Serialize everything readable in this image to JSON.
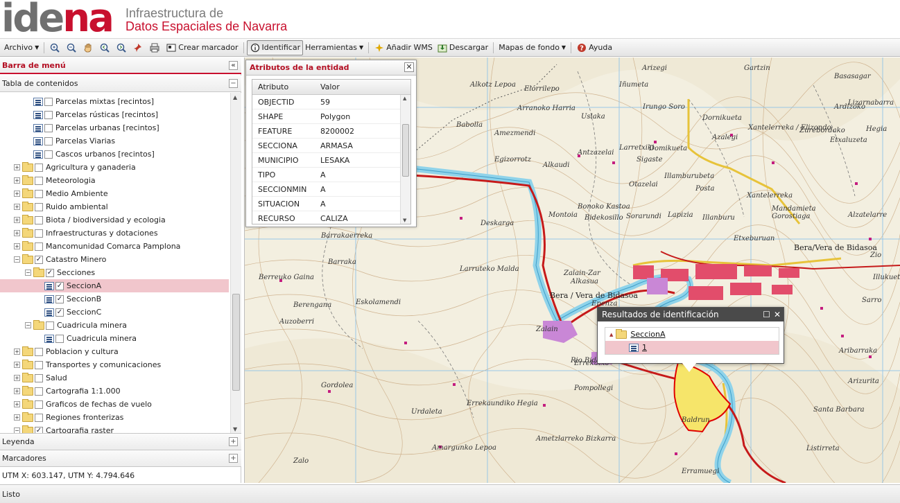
{
  "header": {
    "logo_part1": "ide",
    "logo_part2": "na",
    "subtitle_line1": "Infraestructura de",
    "subtitle_line2": "Datos Espaciales de Navarra"
  },
  "toolbar": {
    "archivo": "Archivo",
    "crear_marcador": "Crear marcador",
    "identificar": "Identificar",
    "herramientas": "Herramientas",
    "anadir_wms": "Añadir WMS",
    "descargar": "Descargar",
    "mapas_fondo": "Mapas de fondo",
    "ayuda": "Ayuda"
  },
  "left_panel": {
    "title": "Barra de menú",
    "toc_title": "Tabla de contenidos",
    "legend_title": "Leyenda",
    "bookmarks_title": "Marcadores",
    "coords": "UTM X: 603.147, UTM Y: 4.794.646"
  },
  "tree": [
    {
      "label": "Parcelas mixtas [recintos]",
      "type": "layer",
      "level": 2,
      "checked": false,
      "expander": "",
      "selected": false
    },
    {
      "label": "Parcelas rústicas [recintos]",
      "type": "layer",
      "level": 2,
      "checked": false,
      "expander": "",
      "selected": false
    },
    {
      "label": "Parcelas urbanas [recintos]",
      "type": "layer",
      "level": 2,
      "checked": false,
      "expander": "",
      "selected": false
    },
    {
      "label": "Parcelas Viarias",
      "type": "layer",
      "level": 2,
      "checked": false,
      "expander": "",
      "selected": false
    },
    {
      "label": "Cascos urbanos [recintos]",
      "type": "layer",
      "level": 2,
      "checked": false,
      "expander": "",
      "selected": false
    },
    {
      "label": "Agricultura y ganaderia",
      "type": "folder",
      "level": 0,
      "checked": false,
      "expander": "+",
      "selected": false
    },
    {
      "label": "Meteorologia",
      "type": "folder",
      "level": 0,
      "checked": false,
      "expander": "+",
      "selected": false
    },
    {
      "label": "Medio Ambiente",
      "type": "folder",
      "level": 0,
      "checked": false,
      "expander": "+",
      "selected": false
    },
    {
      "label": "Ruido ambiental",
      "type": "folder",
      "level": 0,
      "checked": false,
      "expander": "+",
      "selected": false
    },
    {
      "label": "Biota / biodiversidad y ecologia",
      "type": "folder",
      "level": 0,
      "checked": false,
      "expander": "+",
      "selected": false
    },
    {
      "label": "Infraestructuras y dotaciones",
      "type": "folder",
      "level": 0,
      "checked": false,
      "expander": "+",
      "selected": false
    },
    {
      "label": "Mancomunidad Comarca Pamplona",
      "type": "folder",
      "level": 0,
      "checked": false,
      "expander": "+",
      "selected": false
    },
    {
      "label": "Catastro Minero",
      "type": "folder",
      "level": 0,
      "checked": true,
      "expander": "−",
      "selected": false
    },
    {
      "label": "Secciones",
      "type": "folder",
      "level": 1,
      "checked": true,
      "expander": "−",
      "selected": false
    },
    {
      "label": "SeccionA",
      "type": "layer",
      "level": 3,
      "checked": true,
      "expander": "",
      "selected": true
    },
    {
      "label": "SeccionB",
      "type": "layer",
      "level": 3,
      "checked": true,
      "expander": "",
      "selected": false
    },
    {
      "label": "SeccionC",
      "type": "layer",
      "level": 3,
      "checked": true,
      "expander": "",
      "selected": false
    },
    {
      "label": "Cuadricula minera",
      "type": "folder",
      "level": 1,
      "checked": false,
      "expander": "−",
      "selected": false
    },
    {
      "label": "Cuadricula minera",
      "type": "layer",
      "level": 3,
      "checked": false,
      "expander": "",
      "selected": false
    },
    {
      "label": "Poblacion y cultura",
      "type": "folder",
      "level": 0,
      "checked": false,
      "expander": "+",
      "selected": false
    },
    {
      "label": "Transportes y comunicaciones",
      "type": "folder",
      "level": 0,
      "checked": false,
      "expander": "+",
      "selected": false
    },
    {
      "label": "Salud",
      "type": "folder",
      "level": 0,
      "checked": false,
      "expander": "+",
      "selected": false
    },
    {
      "label": "Cartografia 1:1.000",
      "type": "folder",
      "level": 0,
      "checked": false,
      "expander": "+",
      "selected": false
    },
    {
      "label": "Graficos de fechas de vuelo",
      "type": "folder",
      "level": 0,
      "checked": false,
      "expander": "+",
      "selected": false
    },
    {
      "label": "Regiones fronterizas",
      "type": "folder",
      "level": 0,
      "checked": false,
      "expander": "+",
      "selected": false
    },
    {
      "label": "Cartografia raster",
      "type": "folder",
      "level": 0,
      "checked": true,
      "expander": "−",
      "selected": false
    }
  ],
  "attributes_window": {
    "title": "Atributos de la entidad",
    "col_attr": "Atributo",
    "col_value": "Valor",
    "rows": [
      {
        "k": "OBJECTID",
        "v": "59"
      },
      {
        "k": "SHAPE",
        "v": "Polygon"
      },
      {
        "k": "FEATURE",
        "v": "8200002"
      },
      {
        "k": "SECCIONA",
        "v": "ARMASA"
      },
      {
        "k": "MUNICIPIO",
        "v": "LESAKA"
      },
      {
        "k": "TIPO",
        "v": "A"
      },
      {
        "k": "SECCIONMIN",
        "v": "A"
      },
      {
        "k": "SITUACION",
        "v": "A"
      },
      {
        "k": "RECURSO",
        "v": "CALIZA"
      }
    ]
  },
  "results_window": {
    "title": "Resultados de identificación",
    "layer": "SeccionA",
    "feature": "1"
  },
  "map_labels": [
    "Arizegi",
    "Gartzin",
    "Basasagar",
    "Alkotz Lepoa",
    "Elorrilepo",
    "Iñumeta",
    "Irungo Soro",
    "Lizarnabarra",
    "Ardizoko",
    "Arranoko Harria",
    "Uslaka",
    "Dornikueta",
    "Xantelerreka / Elizondo",
    "Zurebordako",
    "Hegia",
    "Babolla",
    "Amezmendi",
    "Azalegi",
    "Etxaluzeta",
    "Egizorrotz",
    "Alkaudi",
    "Antzazelai",
    "Larretxiki",
    "Domikueta",
    "Sigaste",
    "Otazelai",
    "Illamburubeta",
    "Posta",
    "Xantelerreka",
    "Mandamieta",
    "Alzatelarre",
    "Bonoko Kastoa",
    "Sorarundi",
    "Lapizia",
    "Illanburu",
    "Gorostiaga",
    "Deskarga",
    "Montoia",
    "Bidekosillo",
    "Etxeburuan",
    "Barrakaerreka",
    "Barraka",
    "Larruteko Malda",
    "Zalain-Zar",
    "Bera/Vera de Bidasoa",
    "Zio",
    "Illukueta",
    "Berreuko Gaina",
    "Alkasua",
    "Bera / Vera de Bidasoa",
    "Epenza",
    "Berengana",
    "Eskolamendi",
    "Sarro",
    "Auzoberri",
    "Zalain",
    "Errekatxo",
    "Aribarraka",
    "Gordolea",
    "Pompollegi",
    "Arizurita",
    "Errekaundiko Hegia",
    "Urdaleta",
    "Baldrun",
    "Santa Barbara",
    "Amargunko Lepoa",
    "Ametzlarreko Bizkarra",
    "Listirreta",
    "Erramuegi",
    "Zalo",
    "Rio Bidasoa"
  ],
  "status": "Listo"
}
